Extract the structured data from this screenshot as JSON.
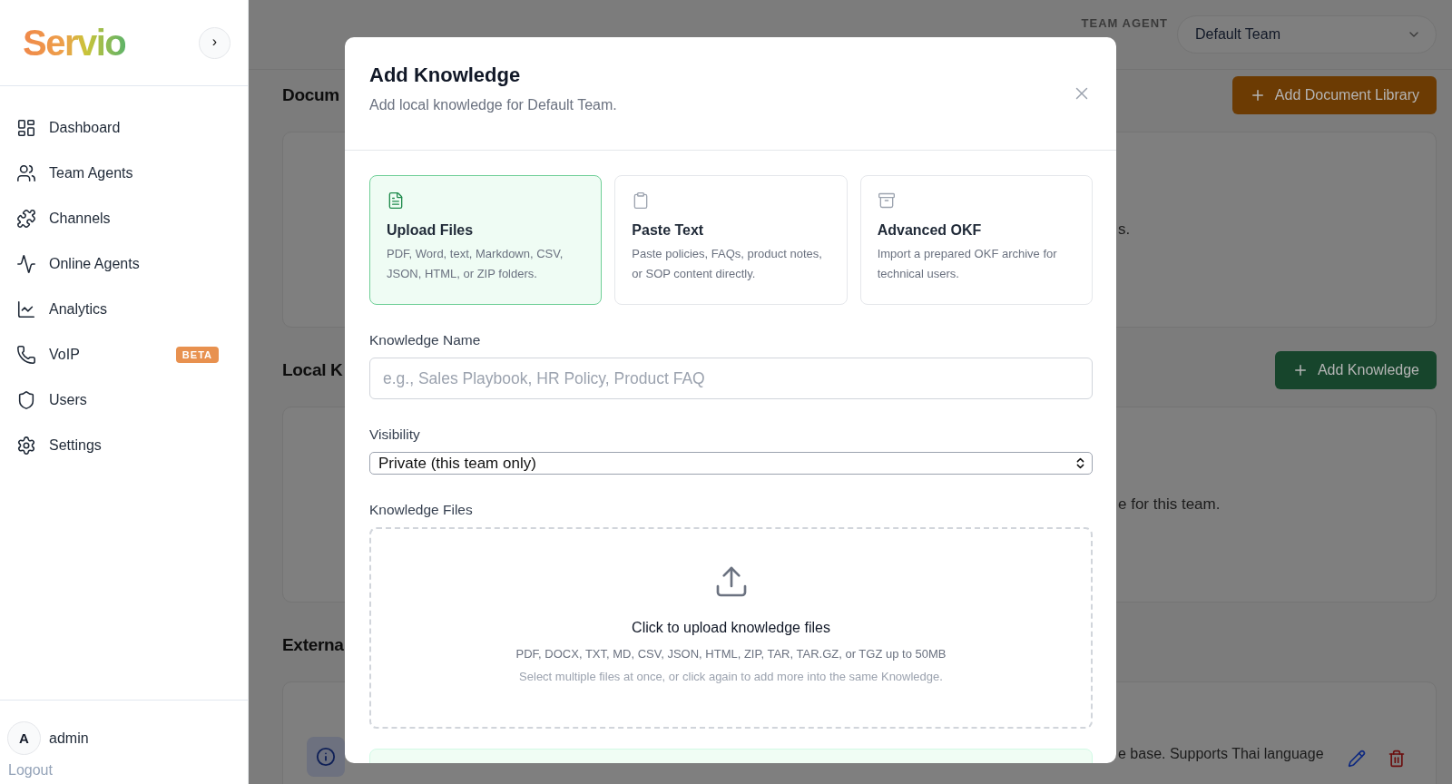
{
  "sidebar": {
    "logo": "Servio",
    "collapse_button": "›",
    "items": [
      {
        "label": "Dashboard",
        "selected": false
      },
      {
        "label": "Team Agents",
        "selected": false
      },
      {
        "label": "Channels",
        "selected": false
      },
      {
        "label": "Online Agents",
        "selected": false
      },
      {
        "label": "Analytics",
        "selected": false
      },
      {
        "label": "VoIP",
        "selected": false,
        "badge": "BETA"
      },
      {
        "label": "Users",
        "selected": false
      },
      {
        "label": "Settings",
        "selected": false
      }
    ],
    "user": {
      "initial": "A",
      "name": "admin"
    },
    "logout": "Logout"
  },
  "header": {
    "team_label": "TEAM AGENT",
    "team_select": "Default Team"
  },
  "sections": [
    {
      "title": "Docum",
      "button": {
        "label": "Add Document Library",
        "kind": "warning"
      },
      "card": {
        "kind": "empty",
        "text": "s."
      }
    },
    {
      "title": "Local K",
      "button": {
        "label": "Add Knowledge",
        "kind": "primary"
      },
      "card": {
        "kind": "empty",
        "text": "e for this team."
      }
    },
    {
      "title": "Externa",
      "card": {
        "kind": "item",
        "text": "e base. Supports Thai language"
      }
    }
  ],
  "modal": {
    "title": "Add Knowledge",
    "subtitle": "Add local knowledge for Default Team.",
    "source_options": [
      {
        "title": "Upload Files",
        "description": "PDF, Word, text, Markdown, CSV, JSON, HTML, or ZIP folders.",
        "selected": true
      },
      {
        "title": "Paste Text",
        "description": "Paste policies, FAQs, product notes, or SOP content directly.",
        "selected": false
      },
      {
        "title": "Advanced OKF",
        "description": "Import a prepared OKF archive for technical users.",
        "selected": false
      }
    ],
    "name_field": {
      "label": "Knowledge Name",
      "placeholder": "e.g., Sales Playbook, HR Policy, Product FAQ"
    },
    "visibility": {
      "label": "Visibility",
      "value": "Private (this team only)"
    },
    "files": {
      "label": "Knowledge Files",
      "title": "Click to upload knowledge files",
      "formats": "PDF, DOCX, TXT, MD, CSV, JSON, HTML, ZIP, TAR, TAR.GZ, or TGZ up to 50MB",
      "hint": "Select multiple files at once, or click again to add more into the same Knowledge."
    }
  }
}
